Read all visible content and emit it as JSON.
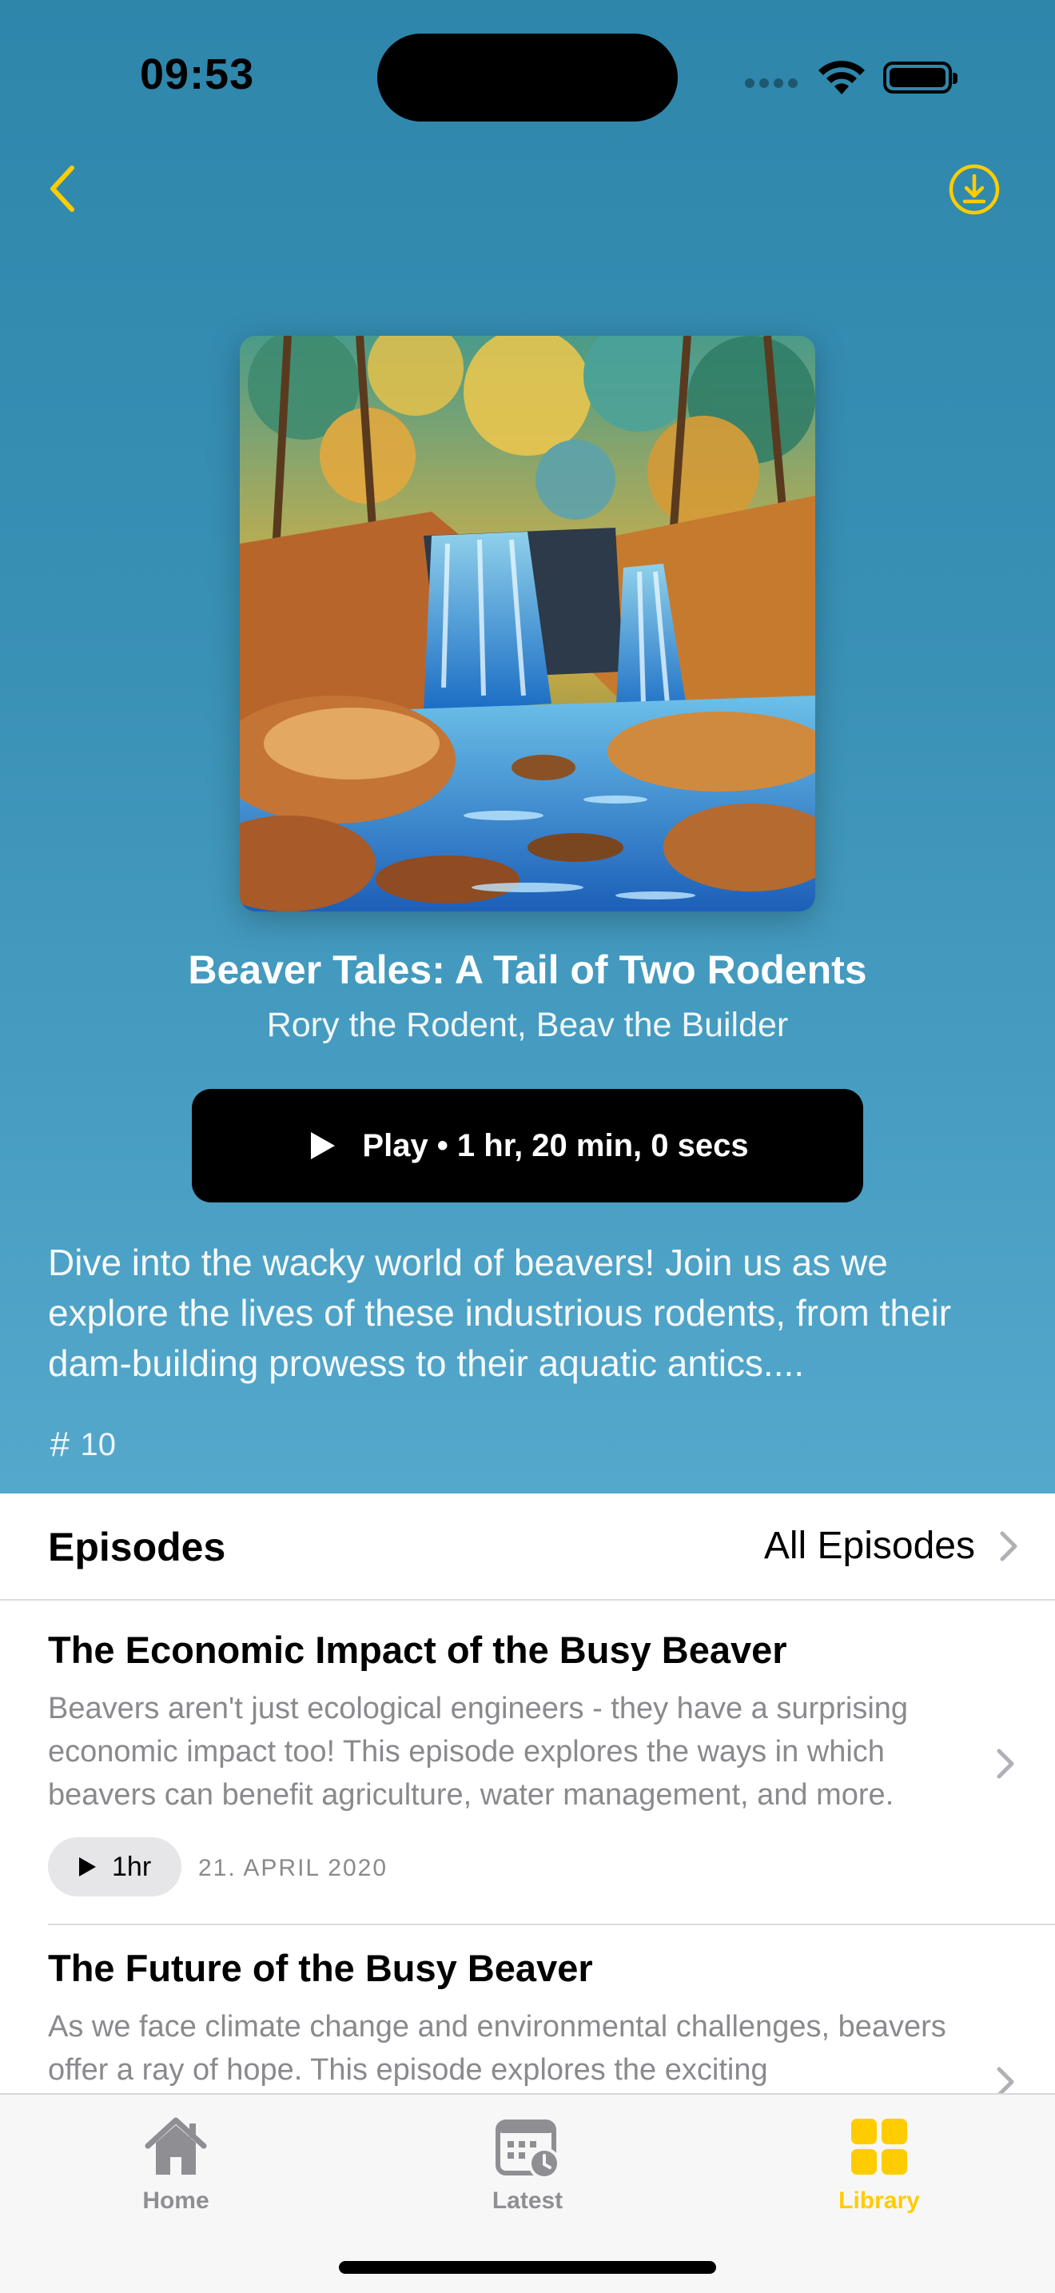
{
  "status_bar": {
    "time": "09:53"
  },
  "nav": {
    "back_icon": "chevron-left-icon",
    "download_icon": "download-circle-icon",
    "accent_color": "#ffcc00"
  },
  "podcast": {
    "title": "Beaver Tales: A Tail of Two Rodents",
    "authors": "Rory the Rodent, Beav the Builder",
    "play_label": "Play • 1 hr, 20 min, 0 secs",
    "description": "Dive into the wacky world of beavers! Join us as we explore the lives of these industrious rodents, from their dam-building prowess to their aquatic antics....",
    "episode_count": "10",
    "hero_color": "#2e86ab"
  },
  "episodes_section": {
    "title": "Episodes",
    "all_label": "All Episodes",
    "items": [
      {
        "title": "The Economic Impact of the Busy Beaver",
        "description": "Beavers aren't just ecological engineers - they have a surprising economic impact too! This episode explores the ways in which beavers can benefit agriculture, water management, and more.",
        "duration": "1hr",
        "date": "21. APRIL 2020"
      },
      {
        "title": "The Future of the Busy Beaver",
        "description": "As we face climate change and environmental challenges, beavers offer a ray of hope. This episode explores the exciting"
      }
    ]
  },
  "tab_bar": {
    "tabs": [
      {
        "label": "Home",
        "icon": "house-icon",
        "active": false
      },
      {
        "label": "Latest",
        "icon": "calendar-clock-icon",
        "active": false
      },
      {
        "label": "Library",
        "icon": "grid-icon",
        "active": true
      }
    ],
    "active_color": "#ffcc00",
    "inactive_color": "#8e8e93"
  }
}
